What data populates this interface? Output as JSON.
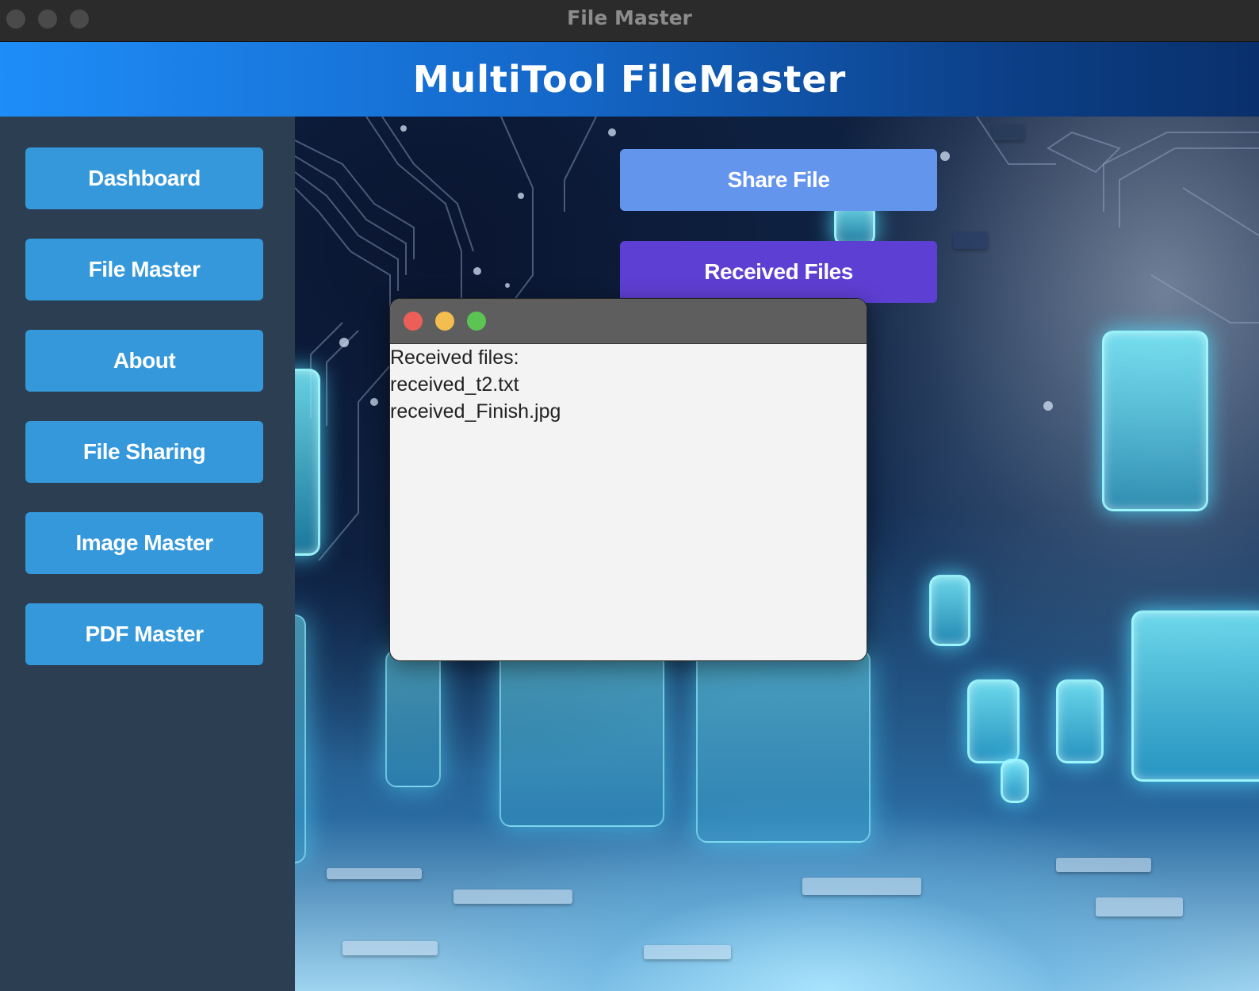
{
  "window": {
    "title": "File Master"
  },
  "header": {
    "app_title": "MultiTool FileMaster"
  },
  "sidebar": {
    "items": [
      {
        "label": "Dashboard"
      },
      {
        "label": "File Master"
      },
      {
        "label": "About"
      },
      {
        "label": "File Sharing"
      },
      {
        "label": "Image Master"
      },
      {
        "label": "PDF Master"
      }
    ]
  },
  "main": {
    "share_label": "Share File",
    "received_label": "Received Files"
  },
  "popup": {
    "lines": [
      "Received files:",
      "received_t2.txt",
      "received_Finish.jpg"
    ]
  },
  "colors": {
    "sidebar_bg": "#2b3e52",
    "sidebar_button": "#3498db",
    "share_button": "#6495ed",
    "received_button": "#5e3fd3",
    "header_start": "#1e8df8",
    "header_end": "#09306b"
  },
  "icons": {
    "close": "close-icon",
    "minimize": "minimize-icon",
    "zoom": "zoom-icon"
  }
}
